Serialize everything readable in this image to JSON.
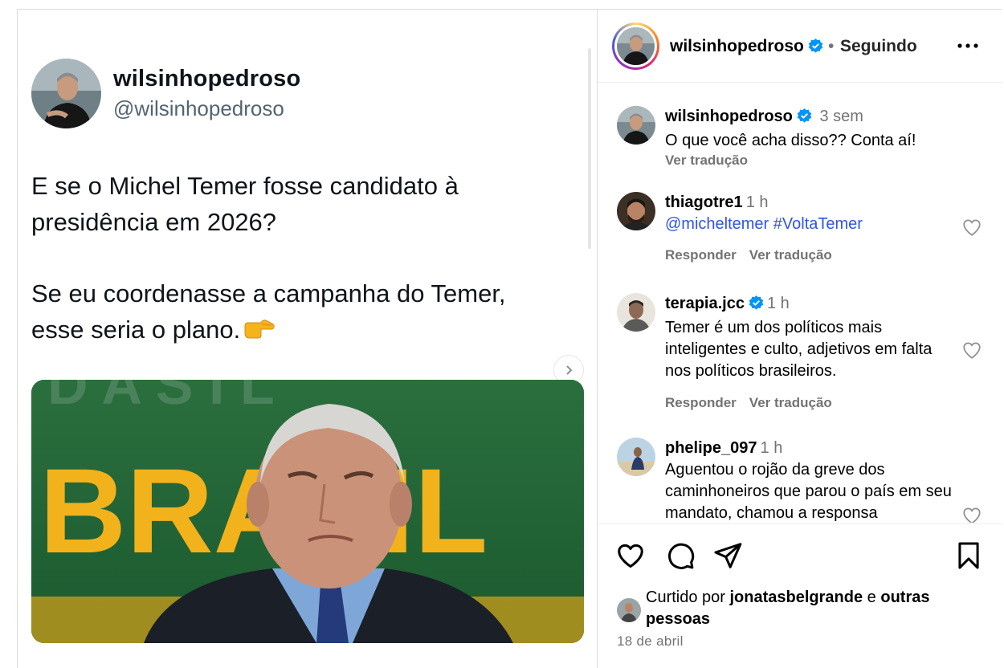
{
  "tweet": {
    "display_name": "wilsinhopedroso",
    "handle": "@wilsinhopedroso",
    "text_line1": "E se o Michel Temer fosse candidato à presidência em 2026?",
    "text_line2": "Se eu coordenasse a campanha do Temer, esse seria o plano.",
    "emoji_icon": "pointing-right-icon",
    "photo_text": "BRASIL"
  },
  "post_header": {
    "username": "wilsinhopedroso",
    "separator": "•",
    "following_label": "Seguindo",
    "more_icon": "more-options-icon"
  },
  "caption": {
    "username": "wilsinhopedroso",
    "time": "3 sem",
    "text": "O que você acha disso?? Conta aí!",
    "translate_label": "Ver tradução"
  },
  "comments": [
    {
      "username": "thiagotre1",
      "time": "1 h",
      "text": "@micheltemer #VoltaTemer",
      "reply_label": "Responder",
      "translate_label": "Ver tradução"
    },
    {
      "username": "terapia.jcc",
      "time": "1 h",
      "text": "Temer é um dos políticos mais inteligentes e culto, adjetivos em falta nos políticos brasileiros.",
      "reply_label": "Responder",
      "translate_label": "Ver tradução"
    },
    {
      "username": "phelipe_097",
      "time": "1 h",
      "text": "Aguentou o rojão da greve dos caminhoneiros que parou o país em seu mandato, chamou a responsa"
    }
  ],
  "likes": {
    "prefix": "Curtido por",
    "user": "jonatasbelgrande",
    "connector": "e",
    "suffix": "outras pessoas"
  },
  "post_date": "18 de abril",
  "colors": {
    "verified_blue": "#0095f6",
    "link_blue": "#3153e6",
    "secondary_text": "#737373",
    "border": "#dbdbdb"
  }
}
